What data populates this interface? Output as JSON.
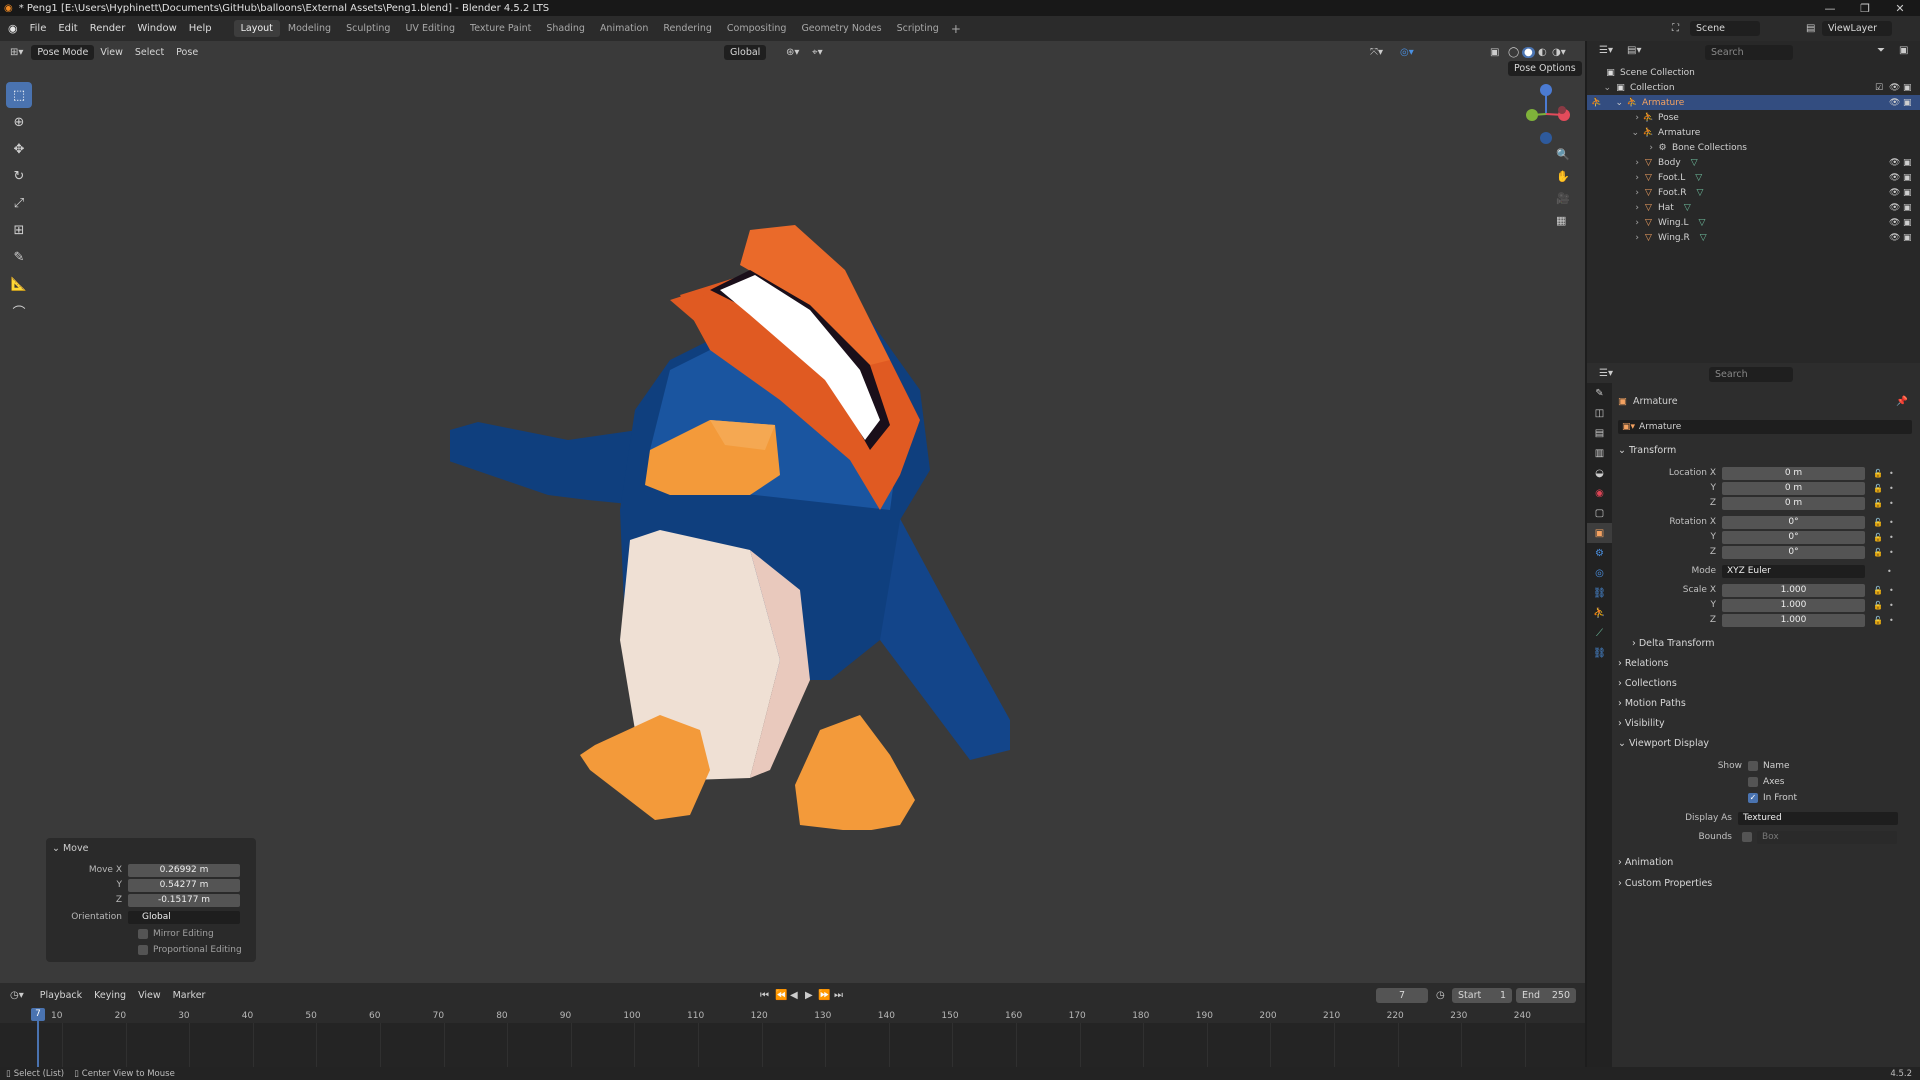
{
  "window": {
    "title": "* Peng1 [E:\\Users\\Hyphinett\\Documents\\GitHub\\balloons\\External Assets\\Peng1.blend] - Blender 4.5.2 LTS"
  },
  "menu": {
    "items": [
      "File",
      "Edit",
      "Render",
      "Window",
      "Help"
    ],
    "workspaces": [
      "Layout",
      "Modeling",
      "Sculpting",
      "UV Editing",
      "Texture Paint",
      "Shading",
      "Animation",
      "Rendering",
      "Compositing",
      "Geometry Nodes",
      "Scripting"
    ],
    "active_workspace": "Layout",
    "scene": "Scene",
    "view_layer": "ViewLayer"
  },
  "viewport": {
    "mode": "Pose Mode",
    "menus": [
      "View",
      "Select",
      "Pose"
    ],
    "orientation": "Global",
    "pose_options": "Pose Options"
  },
  "move_panel": {
    "title": "Move",
    "move_x_label": "Move X",
    "y_label": "Y",
    "z_label": "Z",
    "move_x": "0.26992 m",
    "move_y": "0.54277 m",
    "move_z": "-0.15177 m",
    "orientation_label": "Orientation",
    "orientation": "Global",
    "mirror_editing": "Mirror Editing",
    "proportional_editing": "Proportional Editing"
  },
  "timeline": {
    "menus": [
      "Playback",
      "Keying",
      "View",
      "Marker"
    ],
    "current_frame": "7",
    "start_label": "Start",
    "start": "1",
    "end_label": "End",
    "end": "250",
    "ticks": [
      "10",
      "20",
      "30",
      "40",
      "50",
      "60",
      "70",
      "80",
      "90",
      "100",
      "110",
      "120",
      "130",
      "140",
      "150",
      "160",
      "170",
      "180",
      "190",
      "200",
      "210",
      "220",
      "230",
      "240"
    ]
  },
  "statusbar": {
    "left1": "Select (List)",
    "left2": "Center View to Mouse",
    "version": "4.5.2"
  },
  "outliner": {
    "search_placeholder": "Search",
    "scene_collection": "Scene Collection",
    "collection": "Collection",
    "armature": "Armature",
    "pose": "Pose",
    "armature_data": "Armature",
    "bone_collections": "Bone Collections",
    "objects": [
      "Body",
      "Foot.L",
      "Foot.R",
      "Hat",
      "Wing.L",
      "Wing.R"
    ]
  },
  "properties": {
    "search_placeholder": "Search",
    "object_name": "Armature",
    "object_field": "Armature",
    "transform": "Transform",
    "location_x_label": "Location X",
    "rotation_x_label": "Rotation X",
    "scale_x_label": "Scale X",
    "y_label": "Y",
    "z_label": "Z",
    "loc": [
      "0 m",
      "0 m",
      "0 m"
    ],
    "rot": [
      "0°",
      "0°",
      "0°"
    ],
    "mode_label": "Mode",
    "mode": "XYZ Euler",
    "scale": [
      "1.000",
      "1.000",
      "1.000"
    ],
    "delta_transform": "Delta Transform",
    "relations": "Relations",
    "collections": "Collections",
    "motion_paths": "Motion Paths",
    "visibility": "Visibility",
    "viewport_display": "Viewport Display",
    "show_label": "Show",
    "name": "Name",
    "axes": "Axes",
    "in_front": "In Front",
    "display_as_label": "Display As",
    "display_as": "Textured",
    "bounds_label": "Bounds",
    "bounds": "Box",
    "animation": "Animation",
    "custom_properties": "Custom Properties"
  },
  "colors": {
    "accent": "#4a73b0",
    "selection": "#334d80",
    "viewport_bg": "#3a3a3a",
    "penguin_blue": "#13458a",
    "beak_orange": "#f39a3a",
    "hat_orange": "#e05a22"
  }
}
